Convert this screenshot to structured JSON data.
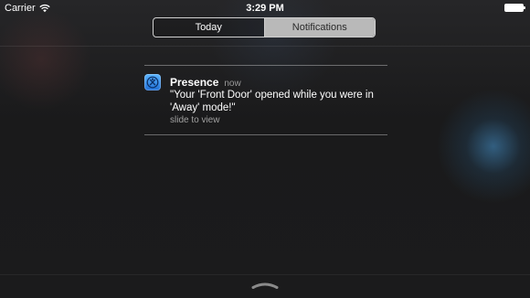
{
  "status_bar": {
    "carrier": "Carrier",
    "time": "3:29 PM",
    "icons": [
      "wifi-icon",
      "battery-icon"
    ]
  },
  "segmented_control": {
    "tabs": [
      {
        "label": "Today",
        "selected": false
      },
      {
        "label": "Notifications",
        "selected": true
      }
    ]
  },
  "notification": {
    "app_name": "Presence",
    "time": "now",
    "message": "\"Your 'Front Door' opened while you were in 'Away' mode!\"",
    "action_hint": "slide to view",
    "icon": "presence-app-icon",
    "icon_color": "#2f86e8"
  },
  "bottom": {
    "icon": "chevron-grabber-icon"
  }
}
